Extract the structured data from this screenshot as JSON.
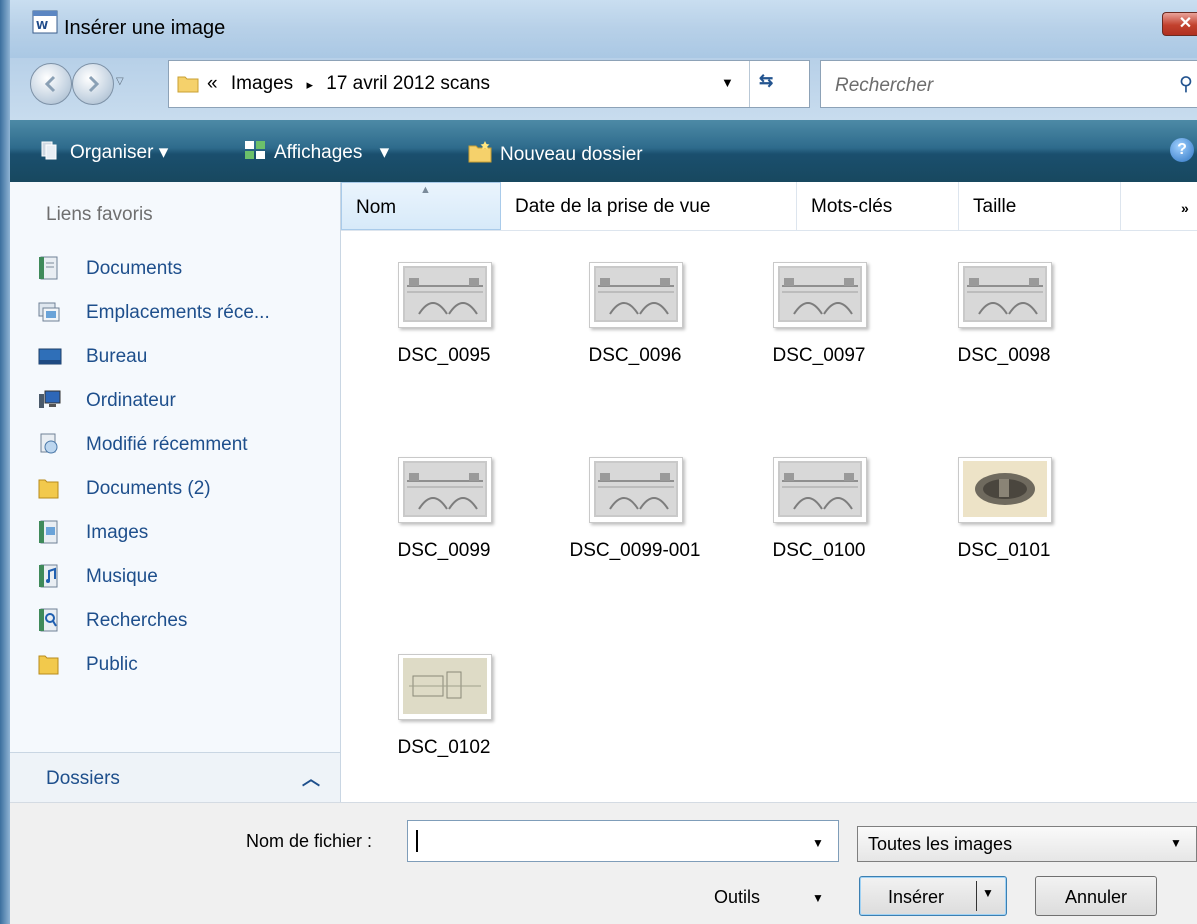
{
  "window": {
    "title": "Insérer une image",
    "close_label": "✕"
  },
  "nav": {
    "breadcrumb_prefix": "«",
    "breadcrumbs": [
      "Images",
      "17 avril 2012 scans"
    ],
    "breadcrumb_separator": "▸",
    "search_placeholder": "Rechercher"
  },
  "toolbar": {
    "organize": "Organiser",
    "views": "Affichages",
    "new_folder": "Nouveau dossier",
    "help": "?"
  },
  "sidebar": {
    "title": "Liens favoris",
    "items": [
      {
        "label": "Documents",
        "icon": "document-icon"
      },
      {
        "label": "Emplacements réce...",
        "icon": "recent-places-icon"
      },
      {
        "label": "Bureau",
        "icon": "desktop-icon"
      },
      {
        "label": "Ordinateur",
        "icon": "computer-icon"
      },
      {
        "label": "Modifié récemment",
        "icon": "recently-changed-icon"
      },
      {
        "label": "Documents (2)",
        "icon": "folder-icon"
      },
      {
        "label": "Images",
        "icon": "pictures-icon"
      },
      {
        "label": "Musique",
        "icon": "music-icon"
      },
      {
        "label": "Recherches",
        "icon": "searches-icon"
      },
      {
        "label": "Public",
        "icon": "folder-icon"
      }
    ],
    "folders_label": "Dossiers"
  },
  "columns": [
    "Nom",
    "Date de la prise de vue",
    "Mots-clés",
    "Taille"
  ],
  "files": [
    {
      "name": "DSC_0095",
      "kind": "bridge-drawing"
    },
    {
      "name": "DSC_0096",
      "kind": "bridge-drawing"
    },
    {
      "name": "DSC_0097",
      "kind": "bridge-drawing"
    },
    {
      "name": "DSC_0098",
      "kind": "bridge-drawing"
    },
    {
      "name": "DSC_0099",
      "kind": "bridge-drawing"
    },
    {
      "name": "DSC_0099-001",
      "kind": "bridge-drawing"
    },
    {
      "name": "DSC_0100",
      "kind": "bridge-drawing"
    },
    {
      "name": "DSC_0101",
      "kind": "engraving"
    },
    {
      "name": "DSC_0102",
      "kind": "sketch"
    }
  ],
  "footer": {
    "filename_label": "Nom de fichier :",
    "filename_value": "",
    "filetype_value": "Toutes les images",
    "tools_label": "Outils",
    "insert_label": "Insérer",
    "cancel_label": "Annuler"
  },
  "colors": {
    "link": "#1e4f8c",
    "toolbar": "#2e6b8c",
    "titlebar": "#b7d0e8"
  }
}
